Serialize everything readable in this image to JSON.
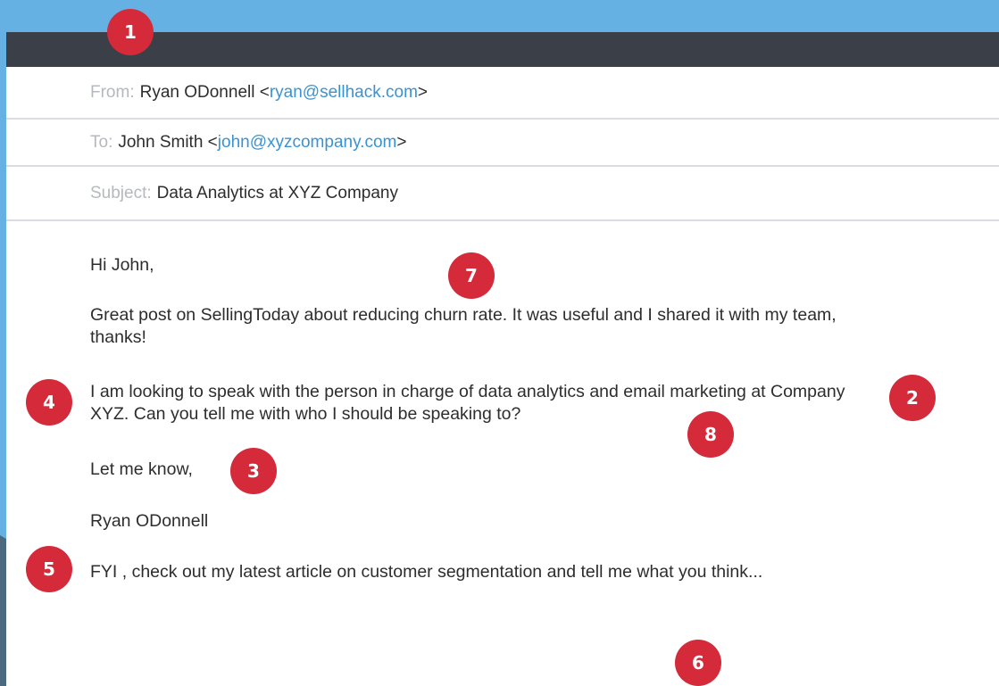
{
  "email": {
    "from_label": "From:",
    "from_name": "Ryan ODonnell <",
    "from_email": "ryan@sellhack.com",
    "from_close": ">",
    "to_label": "To:",
    "to_name": "John Smith <",
    "to_email": "john@xyzcompany.com",
    "to_close": ">",
    "subject_label": "Subject:",
    "subject": "Data Analytics at XYZ Company"
  },
  "body": {
    "greeting": "Hi John,",
    "post": "Great post on SellingToday about reducing churn rate. It was useful and I shared it with my team, thanks!",
    "ask": "I am looking to speak with the person in charge of data analytics and email marketing at Company XYZ. Can you tell me with who I should be speaking to?",
    "let_me_know": "Let me know,",
    "signature": "Ryan ODonnell",
    "fyi_before": "FYI , check out my ",
    "fyi_link": "latest article",
    "fyi_after": " on customer segmentation and tell me what you think..."
  },
  "badges": {
    "b1": "1",
    "b2": "2",
    "b3": "3",
    "b4": "4",
    "b5": "5",
    "b6": "6",
    "b7": "7",
    "b8": "8"
  },
  "colors": {
    "background": "#66b1e3",
    "titlebar": "#3a3f48",
    "link": "#3a93d1",
    "badge": "#d42a3a",
    "envelope_flap": "#4f6e85"
  }
}
